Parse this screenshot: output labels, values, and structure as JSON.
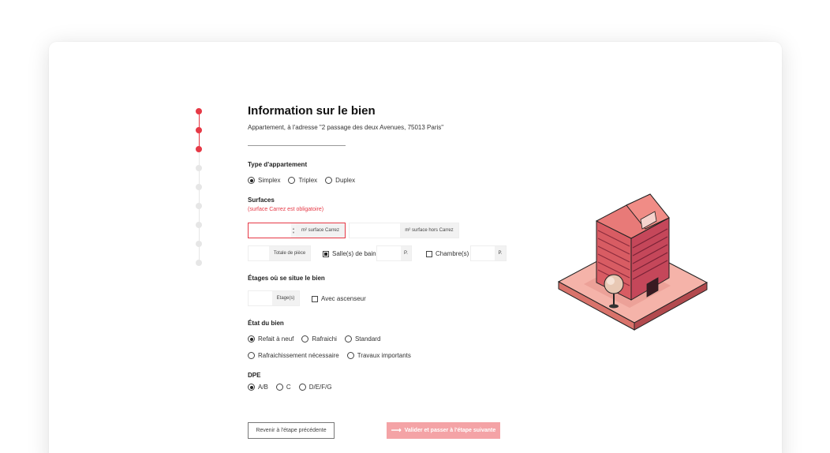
{
  "header": {
    "title": "Information sur le bien",
    "address": "Appartement, à l'adresse \"2 passage des deux Avenues, 75013 Paris\""
  },
  "stepper": {
    "total_steps": 9,
    "completed_steps": 3,
    "active_color": "#e63946",
    "inactive_color": "#e6e6e6"
  },
  "type_appartement": {
    "label": "Type d'appartement",
    "options": [
      {
        "label": "Simplex",
        "selected": true
      },
      {
        "label": "Triplex",
        "selected": false
      },
      {
        "label": "Duplex",
        "selected": false
      }
    ]
  },
  "surfaces": {
    "label": "Surfaces",
    "hint": "(surface Carrez est obligatoire)",
    "carrez_unit": "m² surface Carrez",
    "hors_carrez_unit": "m² surface hors Carrez",
    "pieces_unit": "Totale de pièce",
    "salle_bain_label": "Salle(s) de bain",
    "salle_bain_unit": "P.",
    "chambre_label": "Chambre(s)",
    "chambre_unit": "P."
  },
  "etages": {
    "label": "Étages où se situe le bien",
    "unit": "Etage(s)",
    "ascenseur_label": "Avec ascenseur"
  },
  "etat": {
    "label": "État du bien",
    "options": [
      {
        "label": "Refait à neuf",
        "selected": true
      },
      {
        "label": "Rafraichi",
        "selected": false
      },
      {
        "label": "Standard",
        "selected": false
      },
      {
        "label": "Rafraichissement nécessaire",
        "selected": false
      },
      {
        "label": "Travaux importants",
        "selected": false
      }
    ]
  },
  "dpe": {
    "label": "DPE",
    "options": [
      {
        "label": "A/B",
        "selected": true
      },
      {
        "label": "C",
        "selected": false
      },
      {
        "label": "D/E/F/G",
        "selected": false
      }
    ]
  },
  "buttons": {
    "prev_label": "Revenir à l'étape précédente",
    "next_label": "Valider et passer à l'étape suivante"
  },
  "colors": {
    "accent": "#e63946",
    "button_next_bg": "#f4a3a6"
  },
  "icons": {
    "next_arrow": "arrow-right-icon",
    "illustration": "building-illustration-icon"
  }
}
